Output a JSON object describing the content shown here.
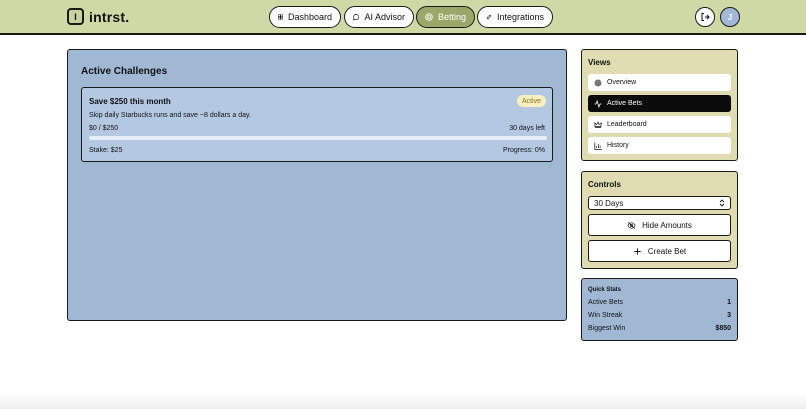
{
  "app": {
    "logo_letter": "I",
    "name": "intrst."
  },
  "nav": [
    {
      "label": "Dashboard",
      "icon": "dashboard-icon",
      "active": false
    },
    {
      "label": "AI Advisor",
      "icon": "chat-icon",
      "active": false
    },
    {
      "label": "Betting",
      "icon": "target-icon",
      "active": true
    },
    {
      "label": "Integrations",
      "icon": "link-icon",
      "active": false
    }
  ],
  "user": {
    "initial": "J"
  },
  "main": {
    "title": "Active Challenges",
    "challenge": {
      "title": "Save $250 this month",
      "status": "Active",
      "description": "Skip daily Starbucks runs and save ~8 dollars a day.",
      "amount": "$0 / $250",
      "days_left": "30 days left",
      "progress_fraction": 0,
      "stake": "Stake: $25",
      "progress_label": "Progress: 0%"
    }
  },
  "views": {
    "title": "Views",
    "items": [
      {
        "label": "Overview",
        "icon": "circle-icon"
      },
      {
        "label": "Active Bets",
        "icon": "activity-icon"
      },
      {
        "label": "Leaderboard",
        "icon": "crown-icon"
      },
      {
        "label": "History",
        "icon": "bar-chart-icon"
      }
    ]
  },
  "controls": {
    "title": "Controls",
    "period_value": "30 Days",
    "hide_label": "Hide Amounts",
    "create_label": "Create Bet"
  },
  "stats": {
    "title": "Quick Stats",
    "rows": [
      {
        "label": "Active Bets",
        "value": "1"
      },
      {
        "label": "Win Streak",
        "value": "3"
      },
      {
        "label": "Biggest Win",
        "value": "$850"
      }
    ]
  },
  "colors": {
    "header_bg": "#cfd9a6",
    "panel_blue": "#a0b8d4",
    "panel_khaki": "#dedcb0",
    "active_nav": "#9aa86a",
    "badge_bg": "#f6efc2"
  }
}
